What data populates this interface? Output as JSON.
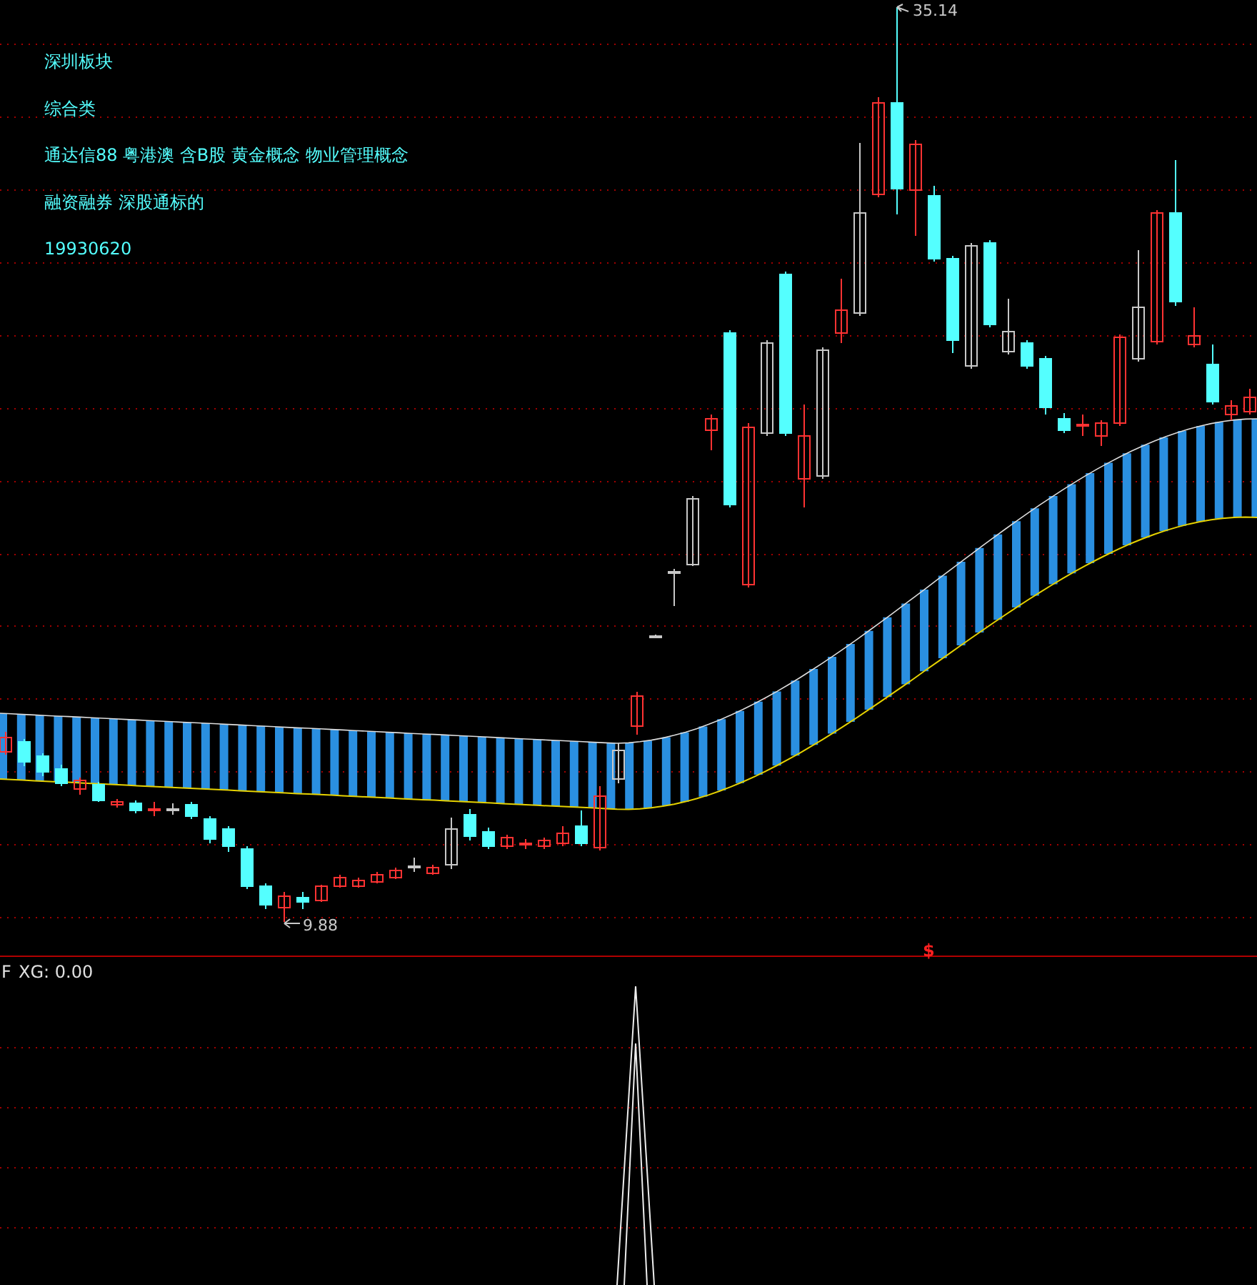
{
  "info_lines": [
    "深圳板块",
    "综合类",
    "通达信88 粤港澳 含B股 黄金概念 物业管理概念",
    "融资融券 深股通标的",
    "19930620"
  ],
  "high_price": "35.14",
  "low_price": "9.88",
  "signal_mark": "$",
  "indicator": {
    "prefix": "F",
    "reading": "XG: 0.00"
  }
}
